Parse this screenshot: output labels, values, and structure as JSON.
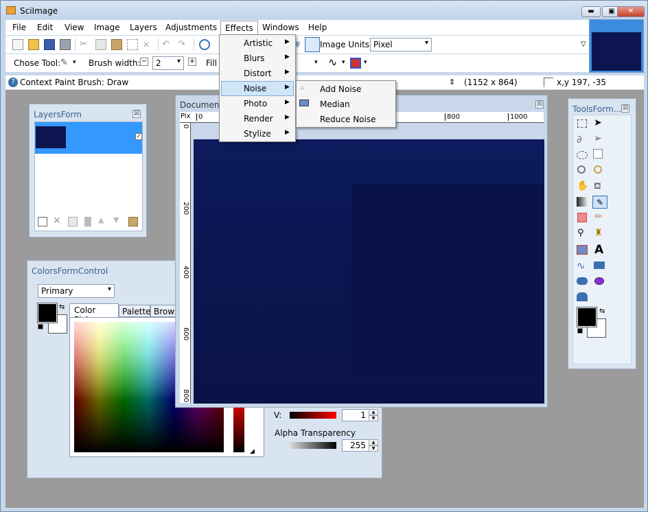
{
  "window": {
    "title": "SciImage",
    "min": "▬",
    "max": "▣",
    "close": "✕"
  },
  "menubar": {
    "items": [
      "File",
      "Edit",
      "View",
      "Image",
      "Layers",
      "Adjustments",
      "Effects",
      "Windows",
      "Help"
    ],
    "active": "Effects"
  },
  "toolbar1": {
    "image_units_label": "Image Units:",
    "image_units_value": "Pixel"
  },
  "toolbar2": {
    "chose_tool_label": "Chose Tool:",
    "brush_width_label": "Brush width:",
    "brush_width_value": "2",
    "fill_label": "Fill"
  },
  "status": {
    "context": "Context Paint Brush: Draw",
    "size": "(1152 x 864)",
    "coords": "x,y 197, -35"
  },
  "effects_menu": {
    "items": [
      {
        "label": "Artistic"
      },
      {
        "label": "Blurs"
      },
      {
        "label": "Distort"
      },
      {
        "label": "Noise"
      },
      {
        "label": "Photo"
      },
      {
        "label": "Render"
      },
      {
        "label": "Stylize"
      }
    ],
    "highlighted": "Noise"
  },
  "noise_submenu": {
    "items": [
      "Add Noise",
      "Median",
      "Reduce Noise"
    ]
  },
  "layers_form": {
    "title": "LayersForm",
    "close": "☒"
  },
  "colors_form": {
    "title": "ColorsFormControl",
    "channel_select": "Primary",
    "tabs": [
      "Color Picker",
      "Palette",
      "Browse"
    ],
    "v_label": "V:",
    "v_value": "1",
    "alpha_label": "Alpha Transparency",
    "alpha_value": "255"
  },
  "document": {
    "title": "Document",
    "close": "☒",
    "ruler_unit": "Pix",
    "ruler_top": [
      "0",
      "800",
      "1000"
    ],
    "ruler_left": [
      "0",
      "200",
      "400",
      "600",
      "800"
    ]
  },
  "tools_form": {
    "title": "ToolsForm...",
    "close": "☒"
  },
  "colors": {
    "canvas": "#0c1550",
    "selection": "#3399ff",
    "mdi_bg": "#9b9b9b",
    "panel": "#d9e4f1"
  }
}
